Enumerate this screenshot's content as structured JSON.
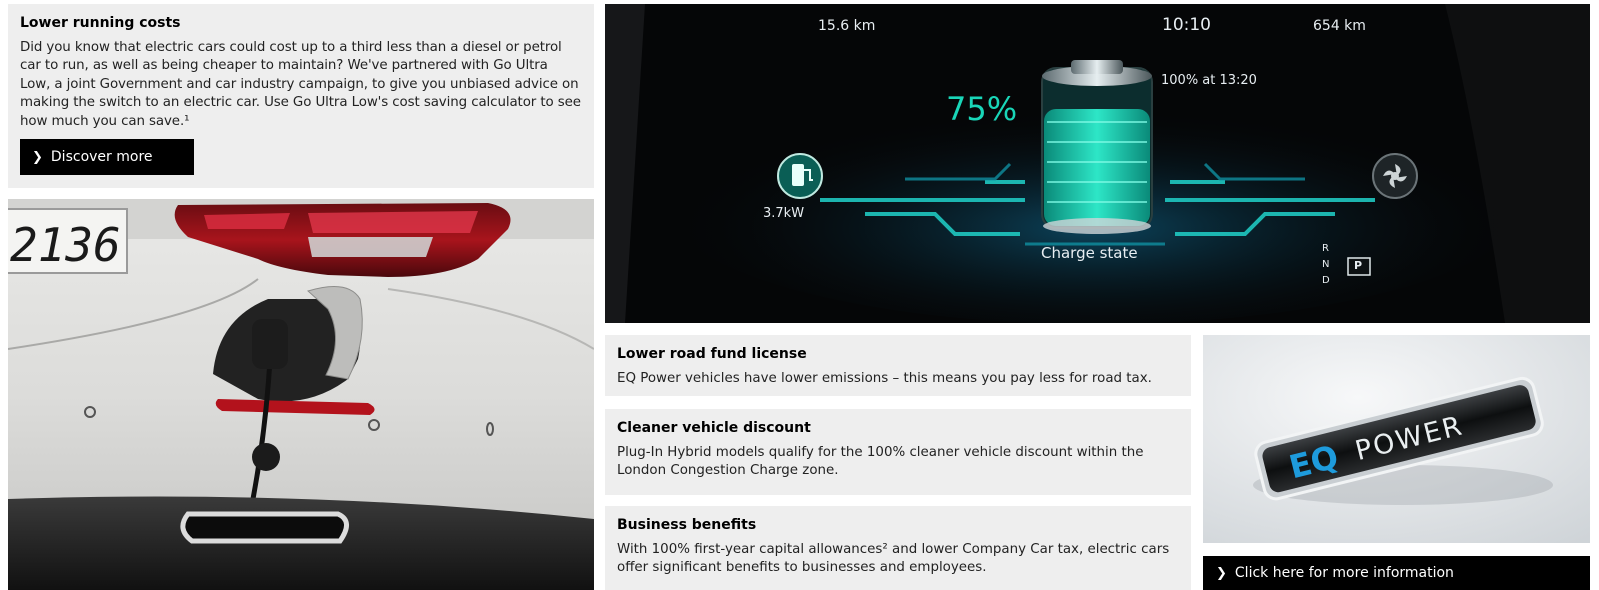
{
  "running_costs": {
    "title": "Lower running costs",
    "body": "Did you know that electric cars could cost up to a third less than a diesel or petrol car to run, as well as being cheaper to maintain? We've partnered with Go Ultra Low, a joint Government and car industry campaign, to give you unbiased advice on making the switch to an electric car. Use Go Ultra Low's cost saving calculator to see how much you can save.¹",
    "button_label": "Discover more",
    "button_icon": "chevron-right-icon"
  },
  "car_image": {
    "plate_text": "2136"
  },
  "dashboard": {
    "trip_distance": "15.6 km",
    "clock": "10:10",
    "range": "654 km",
    "charge_percent": "75%",
    "full_at": "100% at 13:20",
    "charge_power": "3.7kW",
    "charge_state_label": "Charge state",
    "gear_r": "R",
    "gear_n": "N",
    "gear_p": "P",
    "gear_d": "D",
    "charge_level": 0.75,
    "accent_color": "#19d6b8"
  },
  "road_fund": {
    "title": "Lower road fund license",
    "body": "EQ Power vehicles have lower emissions – this means you pay less for road tax."
  },
  "clean_vehicle": {
    "title": "Cleaner vehicle discount",
    "body": "Plug-In Hybrid models qualify for the 100% cleaner vehicle discount within the London Congestion Charge zone."
  },
  "business": {
    "title": "Business benefits",
    "body": "With 100% first-year capital allowances² and lower Company Car tax, electric cars offer significant benefits to businesses and employees."
  },
  "eq_badge": {
    "brand_eq": "EQ",
    "brand_power": "POWER",
    "brand_color": "#1e9bdc"
  },
  "more_info": {
    "button_label": "Click here for more information",
    "button_icon": "chevron-right-icon"
  }
}
